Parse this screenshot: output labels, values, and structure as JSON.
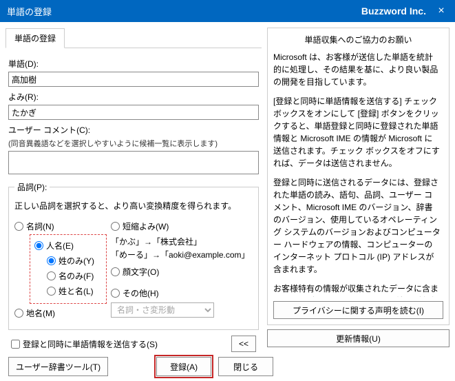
{
  "titlebar": {
    "title": "単語の登録",
    "company": "Buzzword Inc.",
    "close": "×"
  },
  "tab": "単語の登録",
  "labels": {
    "word": "単語(D):",
    "reading": "よみ(R):",
    "comment": "ユーザー コメント(C):",
    "commentSub": "(同音異義語などを選択しやすいように候補一覧に表示します)"
  },
  "values": {
    "word": "高加樹",
    "reading": "たかぎ"
  },
  "pos": {
    "legend": "品詞(P):",
    "hint": "正しい品詞を選択すると、より高い変換精度を得られます。",
    "noun": "名詞(N)",
    "person": "人名(E)",
    "surnameOnly": "姓のみ(Y)",
    "givenOnly": "名のみ(F)",
    "both": "姓と名(L)",
    "place": "地名(M)",
    "shortReading": "短縮よみ(W)",
    "ex1": "「かぶ」→「株式会社」",
    "ex2": "「めーる」→「aoki@example.com」",
    "kaomoji": "顔文字(O)",
    "other": "その他(H)",
    "select": "名詞・さ変形動"
  },
  "sendCheck": "登録と同時に単語情報を送信する(S)",
  "collapseBtn": "<<",
  "rightPanel": {
    "heading": "単語収集へのご協力のお願い",
    "p1": "Microsoft は、お客様が送信した単語を統計的に処理し、その結果を基に、より良い製品の開発を目指しています。",
    "p2": "[登録と同時に単語情報を送信する] チェック ボックスをオンにして [登録] ボタンをクリックすると、単語登録と同時に登録された単語情報と Microsoft IME の情報が Microsoft に送信されます。チェック ボックスをオフにすれば、データは送信されません。",
    "p3": "登録と同時に送信されるデータには、登録された単語の読み、語句、品詞、ユーザー コメント、Microsoft IME のバージョン、辞書のバージョン、使用しているオペレーティング システムのバージョンおよびコンピューター ハードウェアの情報、コンピューターのインターネット プロトコル (IP) アドレスが含まれます。",
    "p4": "お客様特有の情報が収集されたデータに含まれることがあります。このような情報が存在する場合でも、Microsoft では、お客様を特定するために使用することはありません。",
    "privacyBtn": "プライバシーに関する声明を読む(I)"
  },
  "updateBtn": "更新情報(U)",
  "footer": {
    "dict": "ユーザー辞書ツール(T)",
    "register": "登録(A)",
    "close": "閉じる"
  }
}
